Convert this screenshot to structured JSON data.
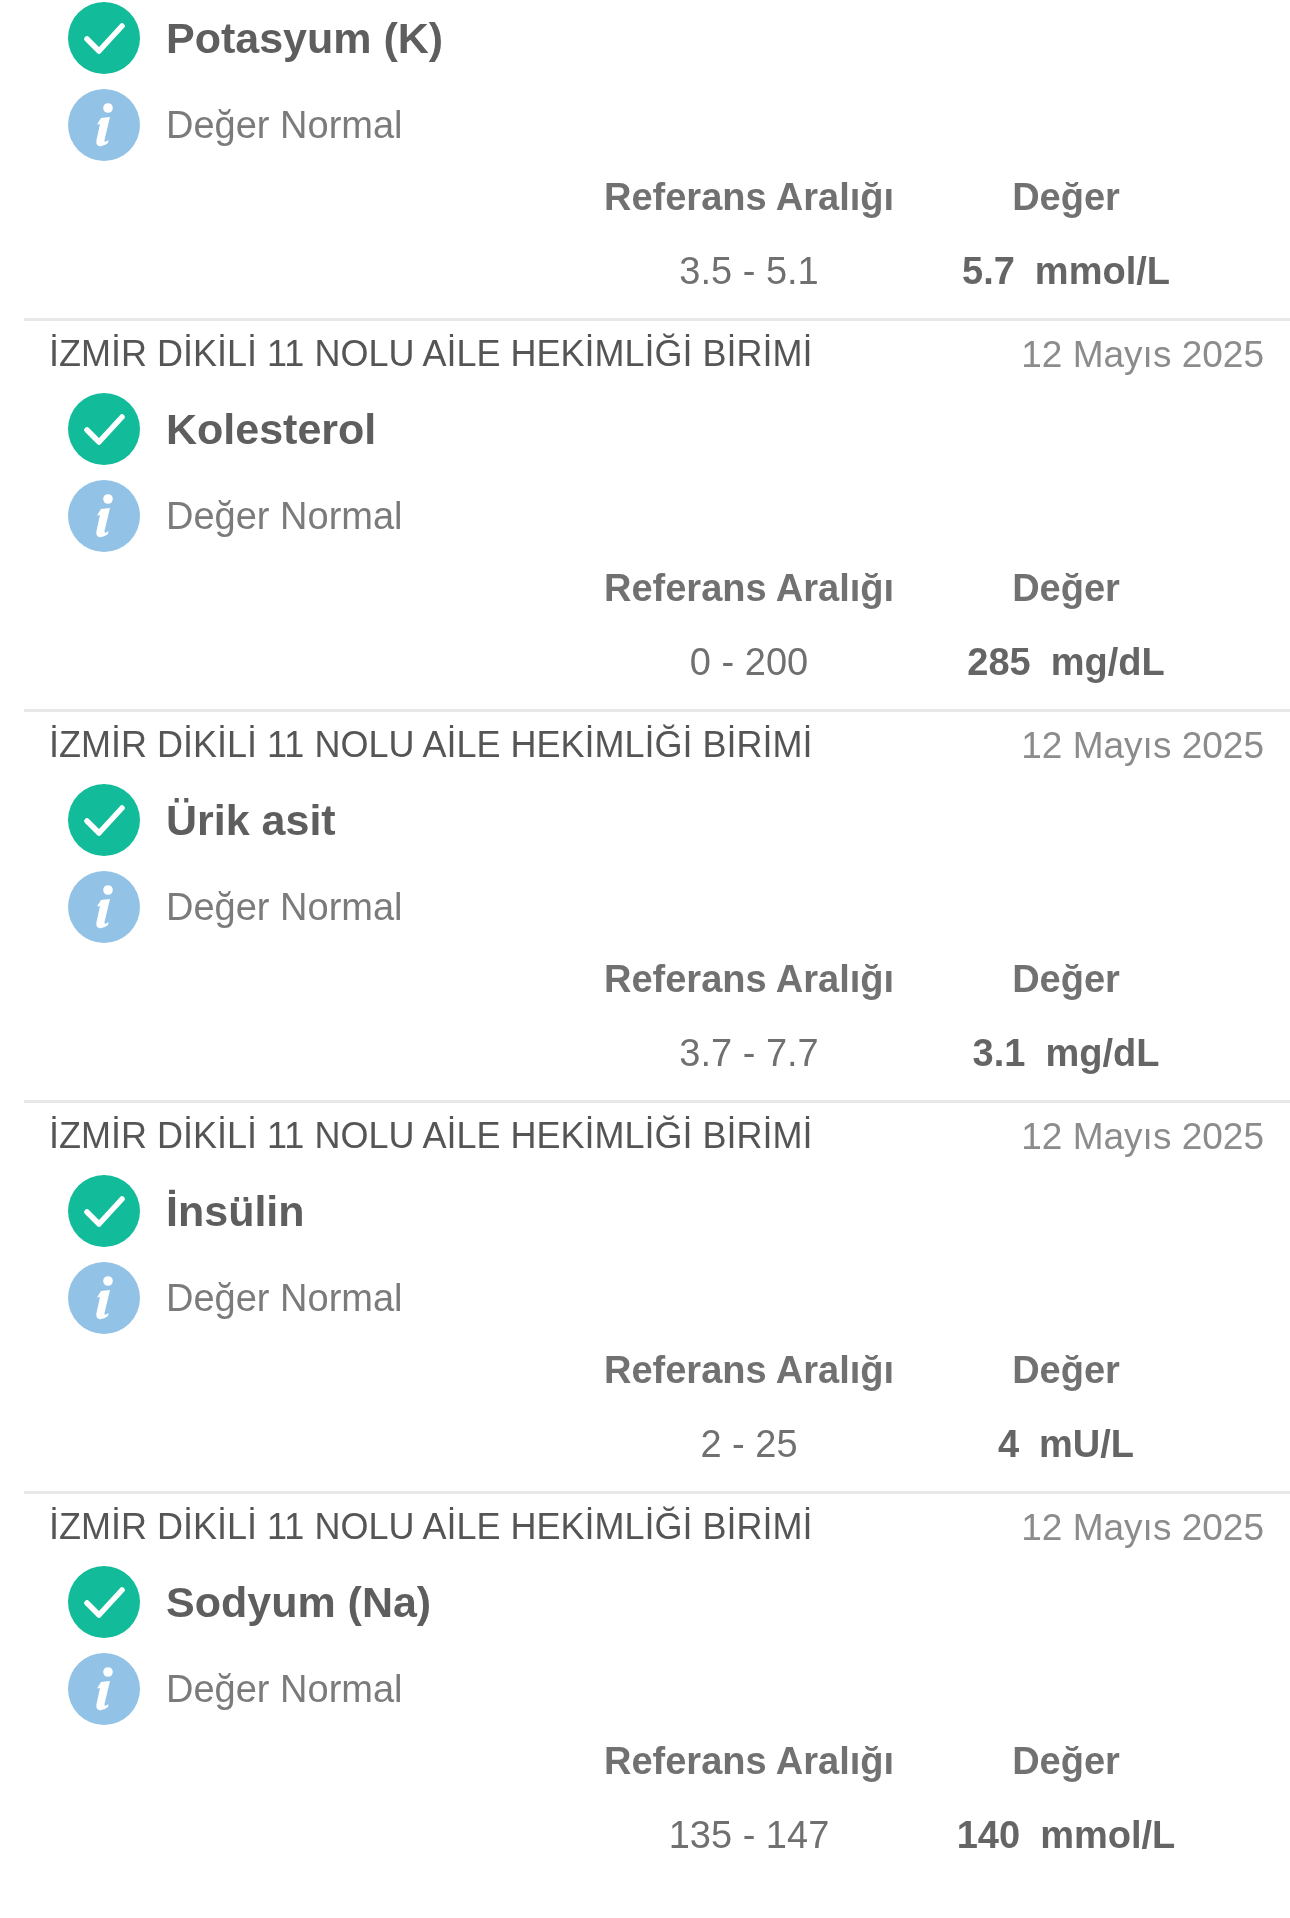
{
  "results": [
    {
      "test": "Potasyum (K)",
      "note": "Değer Normal",
      "range_label": "Referans Aralığı",
      "value_label": "Değer",
      "range": "3.5 - 5.1",
      "value": "5.7",
      "unit": "mmol/L"
    },
    {
      "facility": "İZMİR DİKİLİ 11 NOLU AİLE HEKİMLİĞİ BİRİMİ",
      "date": "12 Mayıs 2025",
      "test": "Kolesterol",
      "note": "Değer Normal",
      "range_label": "Referans Aralığı",
      "value_label": "Değer",
      "range": "0 - 200",
      "value": "285",
      "unit": "mg/dL"
    },
    {
      "facility": "İZMİR DİKİLİ 11 NOLU AİLE HEKİMLİĞİ BİRİMİ",
      "date": "12 Mayıs 2025",
      "test": "Ürik asit",
      "note": "Değer Normal",
      "range_label": "Referans Aralığı",
      "value_label": "Değer",
      "range": "3.7 - 7.7",
      "value": "3.1",
      "unit": "mg/dL"
    },
    {
      "facility": "İZMİR DİKİLİ 11 NOLU AİLE HEKİMLİĞİ BİRİMİ",
      "date": "12 Mayıs 2025",
      "test": "İnsülin",
      "note": "Değer Normal",
      "range_label": "Referans Aralığı",
      "value_label": "Değer",
      "range": "2 - 25",
      "value": "4",
      "unit": "mU/L"
    },
    {
      "facility": "İZMİR DİKİLİ 11 NOLU AİLE HEKİMLİĞİ BİRİMİ",
      "date": "12 Mayıs 2025",
      "test": "Sodyum (Na)",
      "note": "Değer Normal",
      "range_label": "Referans Aralığı",
      "value_label": "Değer",
      "range": "135 - 147",
      "value": "140",
      "unit": "mmol/L"
    }
  ]
}
